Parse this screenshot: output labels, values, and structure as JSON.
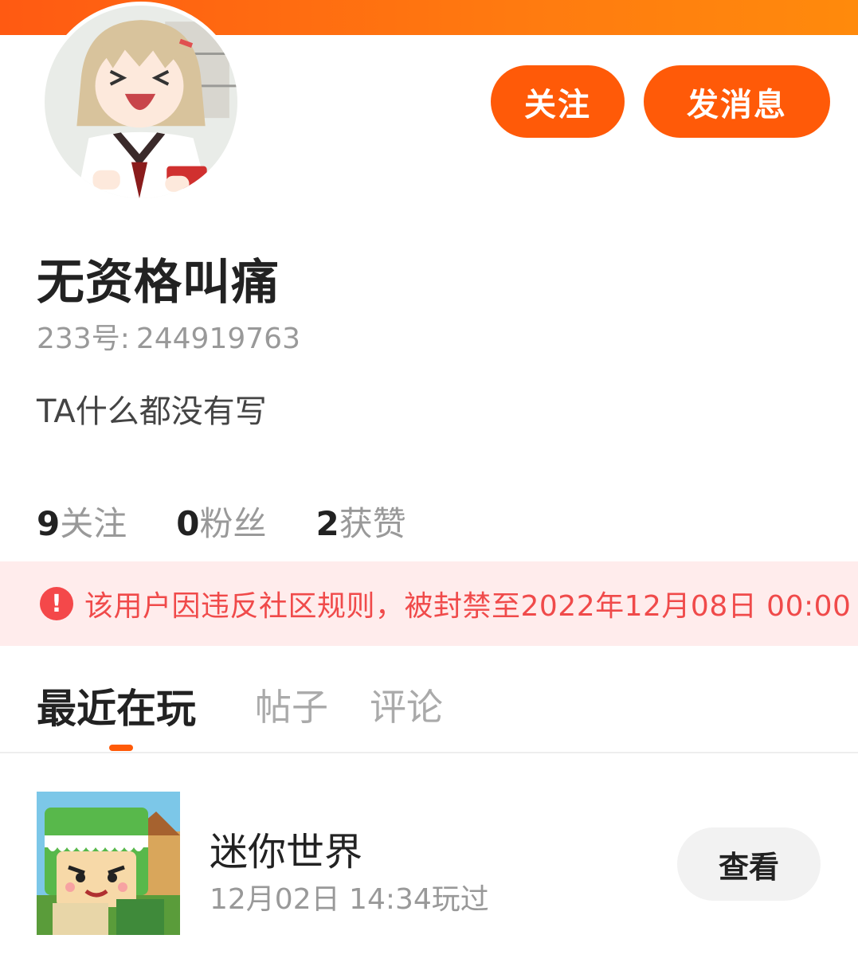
{
  "profile": {
    "username": "无资格叫痛",
    "uid_label": "233号:",
    "uid_value": "244919763",
    "bio": "TA什么都没有写",
    "avatar_icon": "avatar-anime-girl"
  },
  "actions": {
    "follow_label": "关注",
    "message_label": "发消息"
  },
  "stats": [
    {
      "num": "9",
      "label": "关注"
    },
    {
      "num": "0",
      "label": "粉丝"
    },
    {
      "num": "2",
      "label": "获赞"
    }
  ],
  "ban_notice": {
    "icon": "!",
    "text": "该用户因违反社区规则，被封禁至2022年12月08日 00:00"
  },
  "tabs": [
    {
      "label": "最近在玩",
      "active": true
    },
    {
      "label": "帖子",
      "active": false
    },
    {
      "label": "评论",
      "active": false
    }
  ],
  "recent_games": [
    {
      "name": "迷你世界",
      "played": "12月02日 14:34玩过",
      "action": "查看"
    }
  ],
  "colors": {
    "accent": "#ff5a08",
    "ban_bg": "#ffecec",
    "ban_text": "#f04a4a"
  }
}
